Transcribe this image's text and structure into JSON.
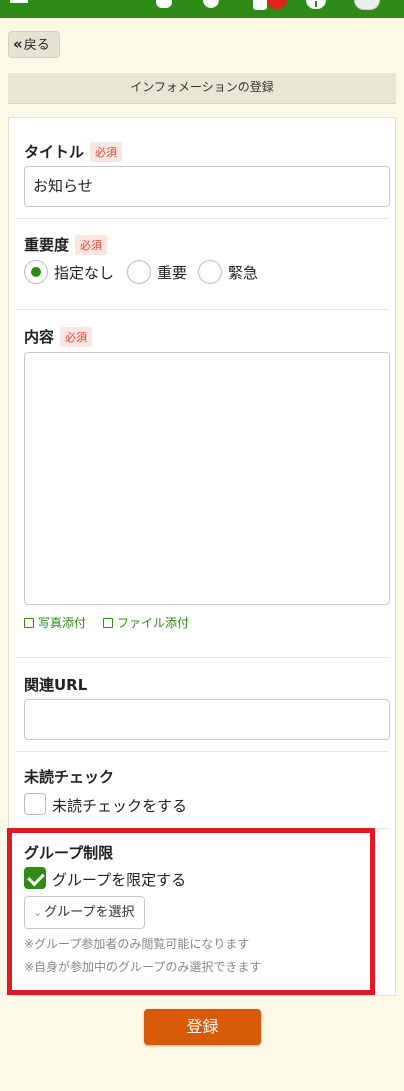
{
  "topbar": {
    "icons": [
      "menu-icon",
      "chat-icon",
      "bell-icon",
      "task-icon",
      "info-icon",
      "avatar"
    ],
    "colors": {
      "bar": "#2e8b16",
      "badge": "#e1251b"
    }
  },
  "nav": {
    "back_label": "戻る",
    "back_chevron": "«"
  },
  "page": {
    "title": "インフォメーションの登録"
  },
  "form": {
    "required_badge": "必須",
    "title_field": {
      "label": "タイトル",
      "value": "お知らせ"
    },
    "importance": {
      "label": "重要度",
      "options": [
        "指定なし",
        "重要",
        "緊急"
      ],
      "selected": "指定なし"
    },
    "content": {
      "label": "内容",
      "value": "",
      "attach_photo": "写真添付",
      "attach_file": "ファイル添付"
    },
    "url": {
      "label": "関連URL",
      "value": ""
    },
    "unread_check": {
      "label": "未読チェック",
      "checkbox_label": "未読チェックをする",
      "checked": false
    },
    "group_limit": {
      "label": "グループ制限",
      "checkbox_label": "グループを限定する",
      "checked": true,
      "select_label": "グループを選択",
      "note1": "※グループ参加者のみ閲覧可能になります",
      "note2": "※自身が参加中のグループのみ選択できます"
    },
    "submit_label": "登録"
  },
  "colors": {
    "accent": "#2e8b16",
    "submit": "#d65a08",
    "highlight": "#e01a25",
    "required": "#e0473a"
  }
}
